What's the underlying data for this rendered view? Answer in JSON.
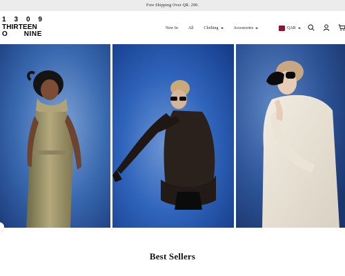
{
  "announcement": {
    "text": "Free Shipping Over QR. 290."
  },
  "brand": {
    "logo_rows": [
      [
        "1",
        "3",
        "0",
        "9"
      ],
      [
        "THIRTEEN"
      ],
      [
        "O",
        "NINE"
      ]
    ],
    "logo_name": "1309 THIRTEEN O NINE"
  },
  "nav": {
    "items": [
      {
        "label": "New In",
        "has_dropdown": false
      },
      {
        "label": "All",
        "has_dropdown": false
      },
      {
        "label": "Clothing",
        "has_dropdown": true
      },
      {
        "label": "Accessories",
        "has_dropdown": true
      }
    ]
  },
  "currency": {
    "label": "QAR",
    "flag_color": "#8a1538"
  },
  "header_icons": [
    "search-icon",
    "account-icon",
    "cart-icon"
  ],
  "hero": {
    "panels": [
      {
        "name": "model-beige-dress",
        "bg": "#2f5fa8"
      },
      {
        "name": "model-crouching-lace",
        "bg": "#2a5ab0"
      },
      {
        "name": "model-white-coat",
        "bg": "#2c4f90"
      }
    ]
  },
  "sections": {
    "best_sellers_title": "Best Sellers"
  },
  "colors": {
    "announcement_bg": "#ececec",
    "accent_flag": "#8a1538"
  }
}
